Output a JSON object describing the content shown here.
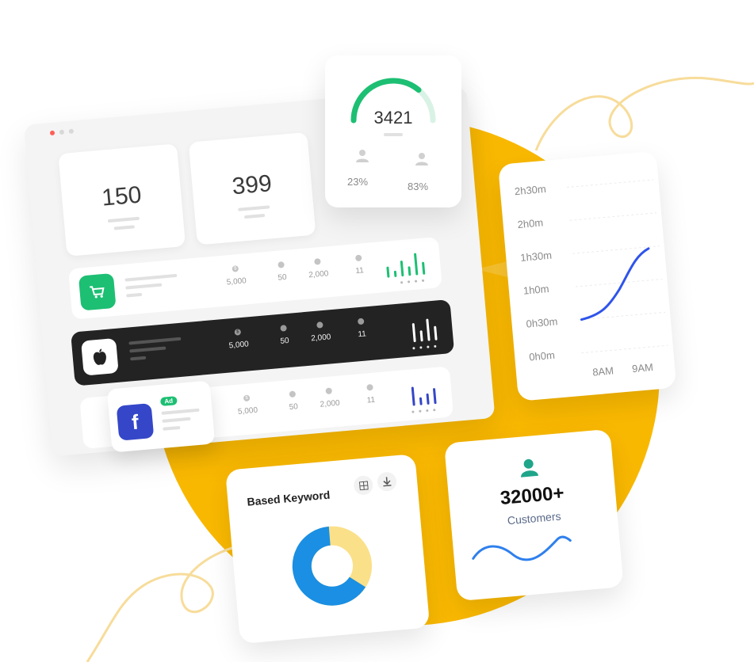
{
  "colors": {
    "accent_yellow": "#F9B800",
    "green": "#1DBF73",
    "blue": "#2F54EB",
    "navy": "#3547C8",
    "teal": "#1FA58A",
    "line_blue": "#2F80ED"
  },
  "stats_top": {
    "left_value": "150",
    "right_value": "399"
  },
  "gauge": {
    "value": "3421",
    "left_percent": "23%",
    "right_percent": "83%",
    "fill_fraction": 0.72
  },
  "campaigns": [
    {
      "name": "shop",
      "icon": "cart-icon",
      "stats": [
        "5,000",
        "50",
        "2,000",
        "11"
      ],
      "bars": [
        14,
        8,
        20,
        12,
        28,
        16
      ],
      "bar_color": "#1DBF73"
    },
    {
      "name": "apple",
      "icon": "apple-icon",
      "stats": [
        "5,000",
        "50",
        "2,000",
        "11"
      ],
      "bars": [
        24,
        14,
        28,
        18
      ],
      "bar_color": "#ffffff"
    },
    {
      "name": "facebook",
      "icon": "facebook-icon",
      "stats": [
        "5,000",
        "50",
        "2,000",
        "11"
      ],
      "bars": [
        24,
        10,
        14,
        20
      ],
      "bar_color": "#3547C8"
    }
  ],
  "fb_card": {
    "badge": "Ad",
    "letter": "f"
  },
  "time_chart": {
    "y_labels": [
      "2h30m",
      "2h0m",
      "1h30m",
      "1h0m",
      "0h30m",
      "0h0m"
    ],
    "x_labels": [
      "8AM",
      "9AM"
    ]
  },
  "keyword_card": {
    "title": "Based Keyword"
  },
  "customer_card": {
    "value": "32000+",
    "label": "Customers"
  }
}
